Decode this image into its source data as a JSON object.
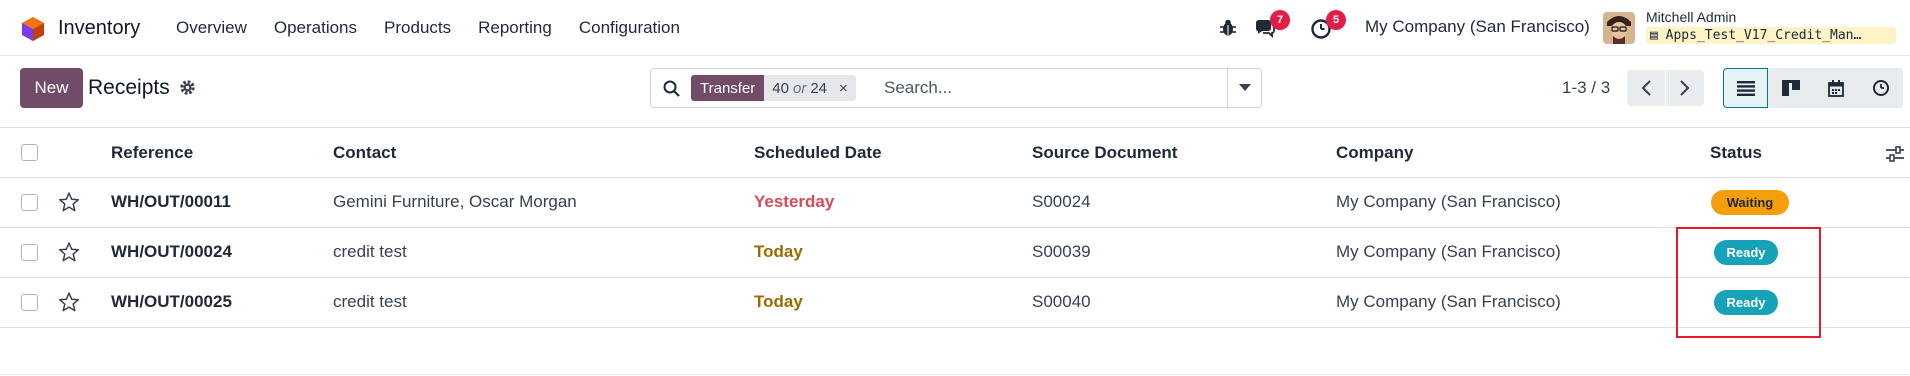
{
  "navbar": {
    "app_name": "Inventory",
    "menu": [
      "Overview",
      "Operations",
      "Products",
      "Reporting",
      "Configuration"
    ],
    "chat_badge": "7",
    "activity_badge": "5",
    "company": "My Company (San Francisco)",
    "user_name": "Mitchell Admin",
    "user_db": "Apps_Test_V17_Credit_Man…"
  },
  "control": {
    "new_label": "New",
    "title": "Receipts",
    "facet_label": "Transfer",
    "facet_v1": "40",
    "facet_or": "or",
    "facet_v2": "24",
    "facet_close": "×",
    "search_placeholder": "Search...",
    "pager": "1-3 / 3"
  },
  "table": {
    "headers": [
      "Reference",
      "Contact",
      "Scheduled Date",
      "Source Document",
      "Company",
      "Status"
    ],
    "rows": [
      {
        "reference": "WH/OUT/00011",
        "contact": "Gemini Furniture, Oscar Morgan",
        "date": "Yesterday",
        "source": "S00024",
        "company": "My Company (San Francisco)",
        "status": "Waiting"
      },
      {
        "reference": "WH/OUT/00024",
        "contact": "credit test",
        "date": "Today",
        "source": "S00039",
        "company": "My Company (San Francisco)",
        "status": "Ready"
      },
      {
        "reference": "WH/OUT/00025",
        "contact": "credit test",
        "date": "Today",
        "source": "S00040",
        "company": "My Company (San Francisco)",
        "status": "Ready"
      }
    ]
  },
  "colors": {
    "brand": "#714b67",
    "accent": "#017e84",
    "waiting": "#f59e0b",
    "ready": "#17a2b8",
    "overdue": "#d44c59",
    "today": "#9a6b01",
    "highlight": "#e11d2c"
  }
}
